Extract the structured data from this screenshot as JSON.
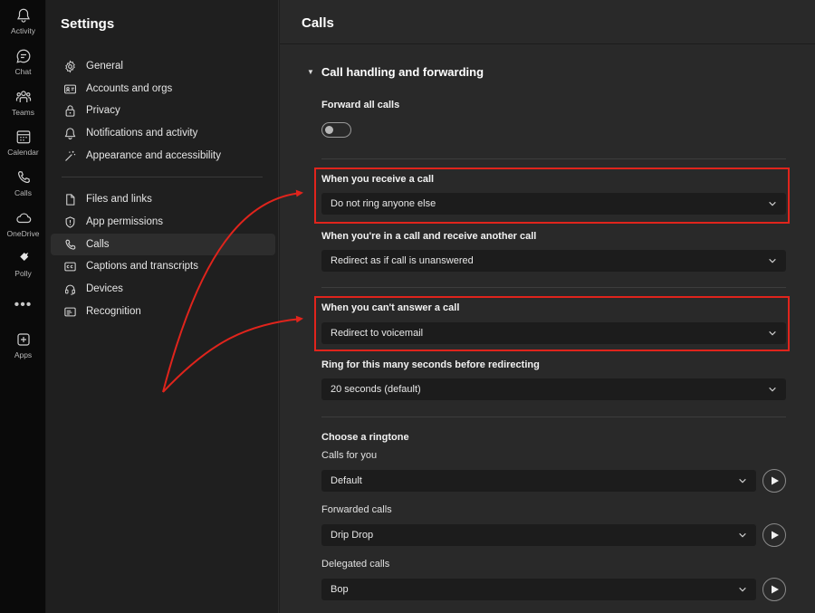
{
  "rail": {
    "items": [
      {
        "label": "Activity",
        "icon": "bell-icon"
      },
      {
        "label": "Chat",
        "icon": "chat-icon"
      },
      {
        "label": "Teams",
        "icon": "teams-icon"
      },
      {
        "label": "Calendar",
        "icon": "calendar-icon"
      },
      {
        "label": "Calls",
        "icon": "phone-icon"
      },
      {
        "label": "OneDrive",
        "icon": "cloud-icon"
      },
      {
        "label": "Polly",
        "icon": "polly-icon"
      },
      {
        "label": "Apps",
        "icon": "plus-square-icon"
      }
    ],
    "more": "•••"
  },
  "settings": {
    "title": "Settings",
    "items": [
      {
        "label": "General",
        "icon": "gear-icon"
      },
      {
        "label": "Accounts and orgs",
        "icon": "id-card-icon"
      },
      {
        "label": "Privacy",
        "icon": "lock-icon"
      },
      {
        "label": "Notifications and activity",
        "icon": "bell-icon"
      },
      {
        "label": "Appearance and accessibility",
        "icon": "wand-icon"
      },
      {
        "label": "Files and links",
        "icon": "file-icon"
      },
      {
        "label": "App permissions",
        "icon": "shield-icon"
      },
      {
        "label": "Calls",
        "icon": "phone-icon",
        "active": true
      },
      {
        "label": "Captions and transcripts",
        "icon": "cc-icon"
      },
      {
        "label": "Devices",
        "icon": "headset-icon"
      },
      {
        "label": "Recognition",
        "icon": "recognition-icon"
      }
    ]
  },
  "main": {
    "title": "Calls",
    "section": "Call handling and forwarding",
    "forward_all_label": "Forward all calls",
    "receive_label": "When you receive a call",
    "receive_value": "Do not ring anyone else",
    "in_call_label": "When you're in a call and receive another call",
    "in_call_value": "Redirect as if call is unanswered",
    "cant_answer_label": "When you can't answer a call",
    "cant_answer_value": "Redirect to voicemail",
    "ring_label": "Ring for this many seconds before redirecting",
    "ring_value": "20 seconds (default)",
    "ringtone_label": "Choose a ringtone",
    "calls_for_you_label": "Calls for you",
    "calls_for_you_value": "Default",
    "forwarded_label": "Forwarded calls",
    "forwarded_value": "Drip Drop",
    "delegated_label": "Delegated calls",
    "delegated_value": "Bop"
  },
  "colors": {
    "highlight": "#e0241c",
    "background": "#292929"
  }
}
